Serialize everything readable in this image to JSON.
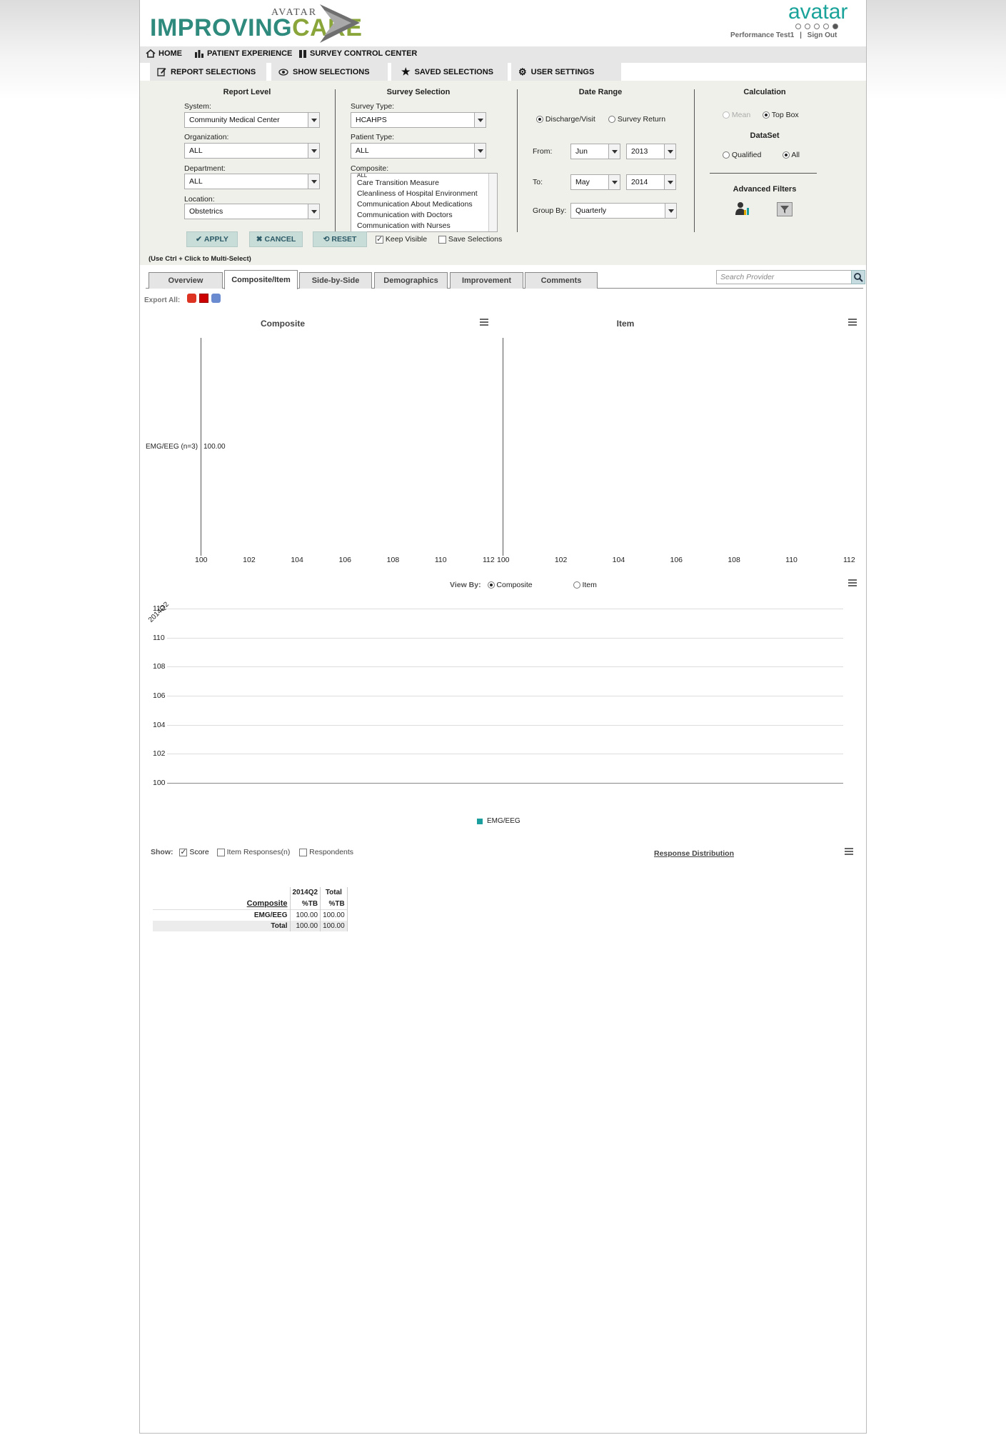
{
  "header": {
    "logo_improving": "IMPROVING",
    "logo_care": "CARE",
    "logo_avatar": "AVATAR",
    "brand": "avatar",
    "user": "Performance Test1",
    "signout": "Sign Out"
  },
  "nav": {
    "home": "HOME",
    "patient_experience": "PATIENT EXPERIENCE",
    "survey_control": "SURVEY CONTROL CENTER"
  },
  "subnav": {
    "report_selections": "REPORT SELECTIONS",
    "show_selections": "SHOW SELECTIONS",
    "saved_selections": "SAVED SELECTIONS",
    "user_settings": "USER SETTINGS"
  },
  "report_level": {
    "title": "Report Level",
    "system_label": "System:",
    "system_value": "Community Medical Center",
    "org_label": "Organization:",
    "org_value": "ALL",
    "dept_label": "Department:",
    "dept_value": "ALL",
    "loc_label": "Location:",
    "loc_value": "Obstetrics"
  },
  "survey_selection": {
    "title": "Survey Selection",
    "survey_type_label": "Survey Type:",
    "survey_type_value": "HCAHPS",
    "patient_type_label": "Patient Type:",
    "patient_type_value": "ALL",
    "composite_label": "Composite:",
    "composite_options": [
      "ALL",
      "Care Transition Measure",
      "Cleanliness of Hospital Environment",
      "Communication About Medications",
      "Communication with Doctors",
      "Communication with Nurses"
    ]
  },
  "date_range": {
    "title": "Date Range",
    "opt_discharge": "Discharge/Visit",
    "opt_return": "Survey Return",
    "from_label": "From:",
    "from_month": "Jun",
    "from_year": "2013",
    "to_label": "To:",
    "to_month": "May",
    "to_year": "2014",
    "group_label": "Group By:",
    "group_value": "Quarterly"
  },
  "calculation": {
    "title": "Calculation",
    "opt_mean": "Mean",
    "opt_topbox": "Top Box",
    "dataset_title": "DataSet",
    "opt_qualified": "Qualified",
    "opt_all": "All",
    "advanced_title": "Advanced Filters"
  },
  "actions": {
    "apply": "APPLY",
    "cancel": "CANCEL",
    "reset": "RESET",
    "keep_visible": "Keep Visible",
    "save_selections": "Save Selections",
    "hint": "(Use Ctrl + Click to Multi-Select)"
  },
  "tabs": [
    "Overview",
    "Composite/Item",
    "Side-by-Side",
    "Demographics",
    "Improvement",
    "Comments"
  ],
  "search_placeholder": "Search Provider",
  "export_label": "Export All:",
  "composite_chart": {
    "title": "Composite",
    "row_label": "EMG/EEG (n=3)",
    "row_value": "100.00",
    "ticks": [
      "100",
      "102",
      "104",
      "106",
      "108",
      "110",
      "112"
    ]
  },
  "item_chart": {
    "title": "Item",
    "ticks": [
      "100",
      "102",
      "104",
      "106",
      "108",
      "110",
      "112"
    ]
  },
  "view_by": {
    "label": "View By:",
    "opt_composite": "Composite",
    "opt_item": "Item"
  },
  "trend_chart": {
    "y_ticks": [
      "112",
      "110",
      "108",
      "106",
      "104",
      "102",
      "100"
    ],
    "x_label": "2014Q2",
    "legend": "EMG/EEG",
    "legend_color": "#1a9e9e"
  },
  "chart_data": [
    {
      "type": "bar",
      "title": "Composite",
      "categories": [
        "EMG/EEG (n=3)"
      ],
      "values": [
        100.0
      ],
      "xlim": [
        100,
        112
      ]
    },
    {
      "type": "bar",
      "title": "Item",
      "categories": [],
      "values": [],
      "xlim": [
        100,
        112
      ]
    },
    {
      "type": "line",
      "categories": [
        "2014Q2"
      ],
      "series": [
        {
          "name": "EMG/EEG",
          "values": [
            100.0
          ]
        }
      ],
      "ylim": [
        100,
        112
      ]
    }
  ],
  "show": {
    "label": "Show:",
    "score": "Score",
    "item_responses": "Item Responses(n)",
    "respondents": "Respondents",
    "response_distribution": "Response Distribution"
  },
  "table": {
    "col1_top": "2014Q2",
    "col2_top": "Total",
    "col1_sub": "%TB",
    "col2_sub": "%TB",
    "header_label": "Composite",
    "rows": [
      {
        "label": "EMG/EEG",
        "c1": "100.00",
        "c2": "100.00"
      },
      {
        "label": "Total",
        "c1": "100.00",
        "c2": "100.00"
      }
    ]
  }
}
